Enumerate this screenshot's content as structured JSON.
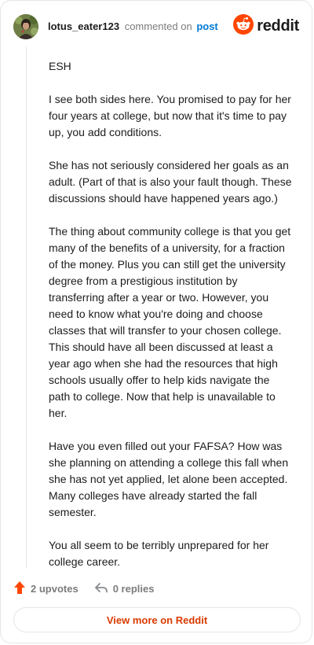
{
  "header": {
    "username": "lotus_eater123",
    "commented_text": "commented on",
    "post_link": "post",
    "brand": "reddit"
  },
  "comment": {
    "paragraphs": [
      "ESH",
      "I see both sides here. You promised to pay for her four years at college, but now that it's time to pay up, you add conditions.",
      "She has not seriously considered her goals as an adult. (Part of that is also your fault though. These discussions should have happened years ago.)",
      "The thing about community college is that you get many of the benefits of a university, for a fraction of the money. Plus you can still get the university degree from a prestigious institution by transferring after a year or two. However, you need to know what you're doing and choose classes that will transfer to your chosen college. This should have all been discussed at least a year ago when she had the resources that high schools usually offer to help kids navigate the path to college. Now that help is unavailable to her.",
      "Have you even filled out your FAFSA? How was she planning on attending a college this fall when she has not yet applied, let alone been accepted. Many colleges have already started the fall semester.",
      "You all seem to be terribly unprepared for her college career."
    ]
  },
  "footer": {
    "upvotes": "2 upvotes",
    "replies": "0 replies",
    "view_button": "View more on Reddit"
  },
  "colors": {
    "upvote": "#ff4500",
    "link": "#0079d3",
    "view_button_text": "#d93a00",
    "brand_orange": "#ff4500"
  },
  "icons": {
    "avatar": "user-avatar",
    "logo": "reddit-logo-icon",
    "upvote": "upvote-arrow-icon",
    "reply": "reply-arrow-icon"
  }
}
